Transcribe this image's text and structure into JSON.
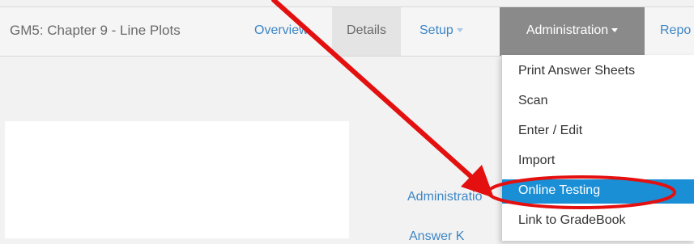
{
  "header": {
    "assessment_title": "GM5: Chapter 9 - Line Plots",
    "nav": {
      "overview": "Overview",
      "details": "Details",
      "setup": "Setup",
      "administration": "Administration",
      "reports": "Repo"
    }
  },
  "administration_menu": {
    "items": [
      {
        "label": "Print Answer Sheets",
        "active": false
      },
      {
        "label": "Scan",
        "active": false
      },
      {
        "label": "Enter / Edit",
        "active": false
      },
      {
        "label": "Import",
        "active": false
      },
      {
        "label": "Online Testing",
        "active": true
      },
      {
        "label": "Link to GradeBook",
        "active": false
      }
    ]
  },
  "side_links": [
    "Administratio",
    "Answer K"
  ],
  "annotation": {
    "arrow_color": "#e3100f",
    "highlight_color": "#e3100f",
    "highlighted_item": "Online Testing"
  },
  "colors": {
    "link": "#3d86c6",
    "active_tab_bg": "#8a8a8a",
    "selected_item_bg": "#1a8fd6"
  }
}
